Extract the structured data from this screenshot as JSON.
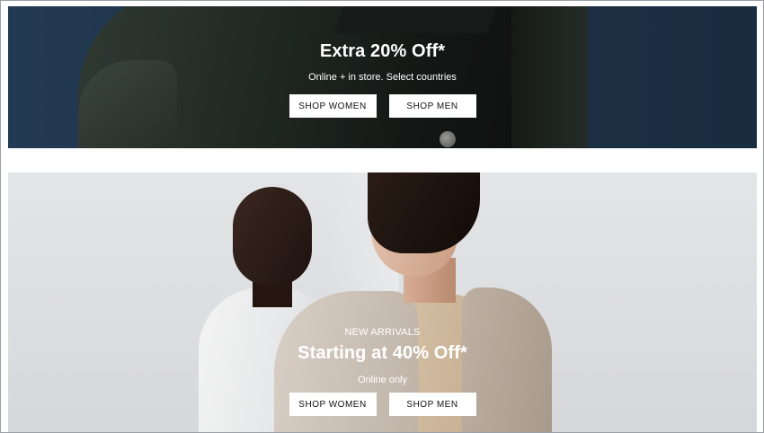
{
  "banners": [
    {
      "eyebrow": "",
      "headline": "Extra 20% Off*",
      "subline": "Online + in store. Select countries",
      "buttons": [
        {
          "label": "SHOP WOMEN"
        },
        {
          "label": "SHOP MEN"
        }
      ]
    },
    {
      "eyebrow": "NEW ARRIVALS",
      "headline": "Starting at 40% Off*",
      "subline": "Online only",
      "buttons": [
        {
          "label": "SHOP WOMEN"
        },
        {
          "label": "SHOP MEN"
        }
      ]
    }
  ],
  "colors": {
    "banner1_bg": "#1d3247",
    "banner2_bg": "#dcdde0",
    "button_bg": "#ffffff",
    "button_text": "#111111",
    "hero_text": "#ffffff"
  }
}
